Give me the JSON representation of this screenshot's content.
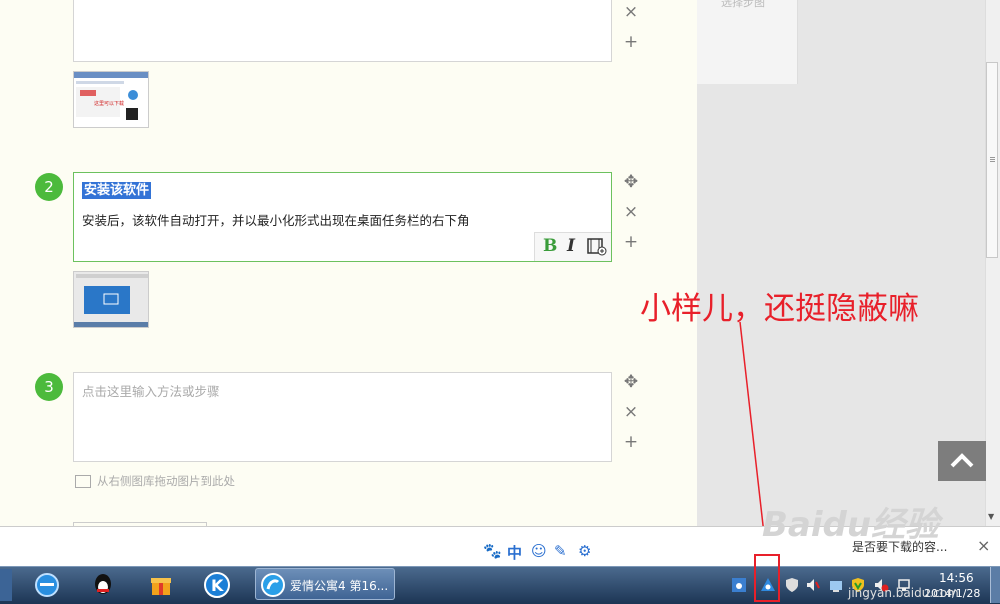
{
  "steps": [
    {
      "number": "2",
      "title": "安装该软件",
      "body": "安装后，该软件自动打开，并以最小化形式出现在桌面任务栏的右下角"
    },
    {
      "number": "3",
      "placeholder": "点击这里输入方法或步骤"
    }
  ],
  "format_toolbar": {
    "bold": "B",
    "italic": "I"
  },
  "controls": {
    "move": "✥",
    "remove": "×",
    "add": "+"
  },
  "drop_hint": "从右侧图库拖动图片到此处",
  "side_panel_label": "选择步图",
  "annotation": "小样儿，还挺隐蔽嘛",
  "notification_text": "是否要下载的容...",
  "notification_close": "×",
  "ime_toolbar": {
    "lang": "中"
  },
  "watermark": "Baidu经验",
  "watermark_url": "jingyan.baidu.com",
  "taskbar": {
    "task_label": "爱情公寓4 第16..."
  },
  "clock": {
    "time": "14:56",
    "date": "2014/1/28"
  },
  "colors": {
    "accent_green": "#4cba3c",
    "selection_blue": "#3373d6",
    "annotation_red": "#e8202a"
  }
}
